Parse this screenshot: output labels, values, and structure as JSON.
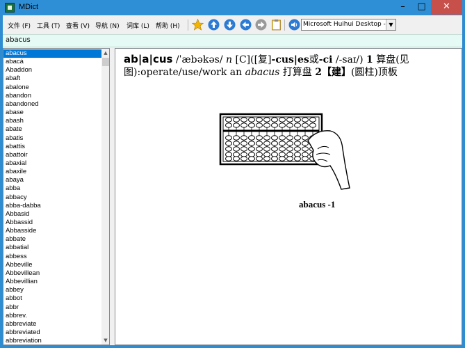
{
  "window": {
    "title": "MDict",
    "minimize_glyph": "–",
    "maximize_glyph": "□",
    "close_glyph": "✕"
  },
  "menu": [
    {
      "label": "文件 (F)"
    },
    {
      "label": "工具 (T)"
    },
    {
      "label": "查看 (V)"
    },
    {
      "label": "导航 (N)"
    },
    {
      "label": "词库 (L)"
    },
    {
      "label": "帮助 (H)"
    }
  ],
  "toolbar": {
    "icons": [
      "star-icon",
      "arrow-up-icon",
      "arrow-down-icon",
      "back-icon",
      "forward-icon",
      "clipboard-icon",
      "speaker-icon"
    ],
    "voice_select_value": "Microsoft Huihui Desktop - C",
    "colors": {
      "blue": "#2b7bd4",
      "star": "#f2b400",
      "grey": "#9a9a9a"
    }
  },
  "search": {
    "value": "abacus"
  },
  "wordlist": [
    "abacus",
    "abacá",
    "Abaddon",
    "abaft",
    "abalone",
    "abandon",
    "abandoned",
    "abase",
    "abash",
    "abate",
    "abatis",
    "abattis",
    "abattoir",
    "abaxial",
    "abaxile",
    "abaya",
    "abba",
    "abbacy",
    "abba-dabba",
    "Abbasid",
    "Abbassid",
    "Abbasside",
    "abbate",
    "abbatial",
    "abbess",
    "Abbeville",
    "Abbevillean",
    "Abbevillian",
    "abbey",
    "abbot",
    "abbr",
    "abbrev.",
    "abbreviate",
    "abbreviated",
    "abbreviation"
  ],
  "selected_word": "abacus",
  "entry": {
    "headword": "ab|a|cus",
    "pron": "/ˈæbəkəs/",
    "pos": "n",
    "grammar": "[C]([复]",
    "plural1": "-cus|es",
    "or": "或",
    "plural2": "-ci",
    "pron2": "/-saɪ/)",
    "sense1_num": "1",
    "sense1": "算盘(见图):operate/use/work an",
    "example_word": "abacus",
    "example_tr": "打算盘",
    "sense2_num": "2",
    "sense2_label": "【建】",
    "sense2": "(圆柱)顶板",
    "figure_caption": "abacus -1"
  }
}
